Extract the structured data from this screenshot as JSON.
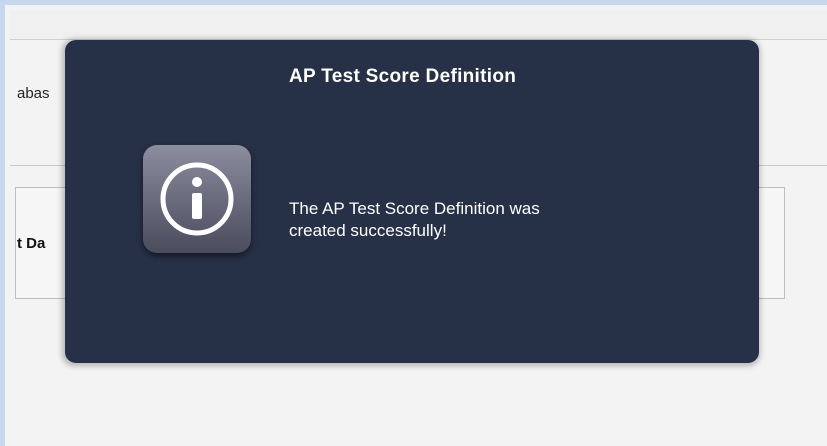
{
  "background": {
    "label_db": "abas",
    "label_date": "t Da"
  },
  "dialog": {
    "title": "AP Test Score Definition",
    "message_line1": "The AP Test Score Definition was",
    "message_line2": "created successfully!",
    "icon": "info-icon"
  },
  "colors": {
    "dialog_bg": "#263046",
    "frame_border": "#c7d7ee"
  }
}
